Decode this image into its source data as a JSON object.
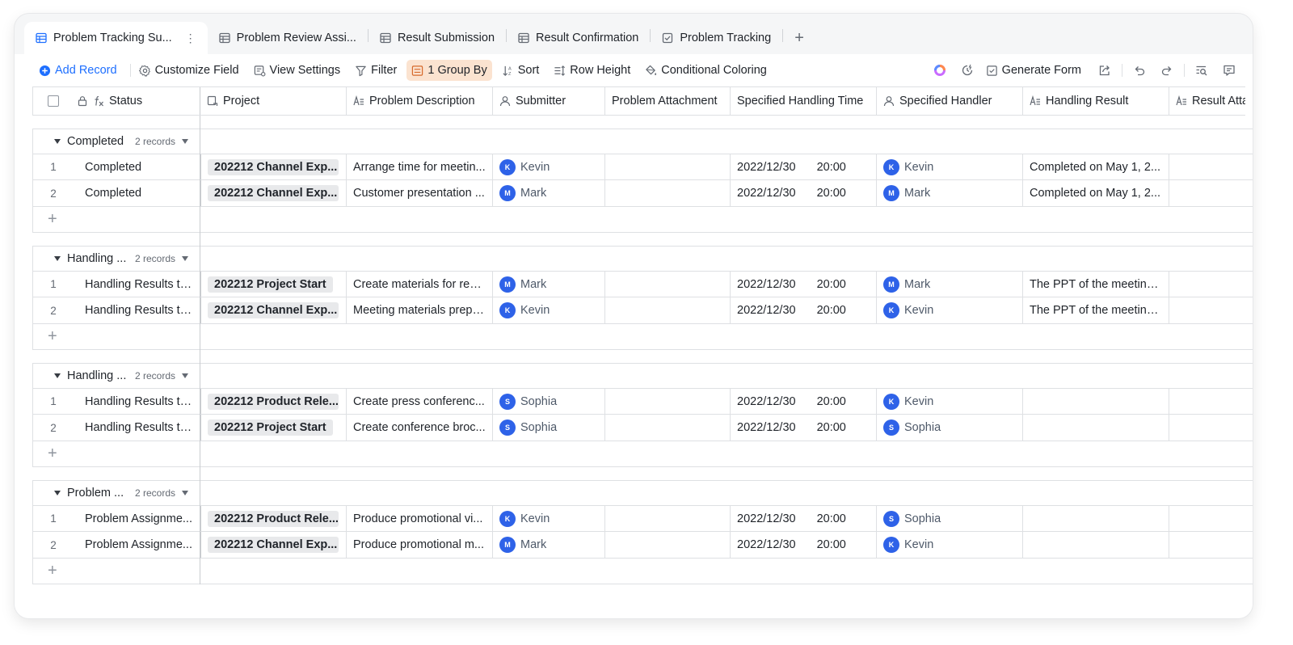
{
  "tabs": [
    {
      "label": "Problem Tracking Su...",
      "icon": "grid-table-icon",
      "active": true
    },
    {
      "label": "Problem Review Assi...",
      "icon": "grid-table-icon"
    },
    {
      "label": "Result Submission",
      "icon": "grid-table-icon"
    },
    {
      "label": "Result Confirmation",
      "icon": "grid-table-icon"
    },
    {
      "label": "Problem Tracking",
      "icon": "checkbox-form-icon"
    }
  ],
  "tab_more": "⋮",
  "tab_add": "+",
  "toolbar": {
    "add_record": "Add Record",
    "customize_field": "Customize Field",
    "view_settings": "View Settings",
    "filter": "Filter",
    "group_by": "1 Group By",
    "sort": "Sort",
    "row_height": "Row Height",
    "conditional_coloring": "Conditional Coloring",
    "generate_form": "Generate Form"
  },
  "columns": {
    "status": "Status",
    "project": "Project",
    "description": "Problem Description",
    "submitter": "Submitter",
    "attachment": "Problem Attachment",
    "time": "Specified Handling Time",
    "handler": "Specified Handler",
    "result": "Handling Result",
    "result_att": "Result Atta"
  },
  "add_row": "+",
  "groups": [
    {
      "name": "Completed",
      "count": "2 records",
      "rows": [
        {
          "n": "1",
          "status": "Completed",
          "project": "202212 Channel Exp...",
          "desc": "Arrange time for meetin...",
          "sub_i": "K",
          "sub": "Kevin",
          "date": "2022/12/30",
          "time": "20:00",
          "hand_i": "K",
          "hand": "Kevin",
          "result": "Completed on May 1, 2..."
        },
        {
          "n": "2",
          "status": "Completed",
          "project": "202212 Channel Exp...",
          "desc": "Customer presentation ...",
          "sub_i": "M",
          "sub": "Mark",
          "date": "2022/12/30",
          "time": "20:00",
          "hand_i": "M",
          "hand": "Mark",
          "result": "Completed on May 1, 2..."
        }
      ]
    },
    {
      "name": "Handling ...",
      "count": "2 records",
      "rows": [
        {
          "n": "1",
          "status": "Handling Results to...",
          "project": "202212 Project Start",
          "desc": "Create materials for regi...",
          "sub_i": "M",
          "sub": "Mark",
          "date": "2022/12/30",
          "time": "20:00",
          "hand_i": "M",
          "hand": "Mark",
          "result": "The PPT of the meeting ..."
        },
        {
          "n": "2",
          "status": "Handling Results to...",
          "project": "202212 Channel Exp...",
          "desc": "Meeting materials prepa...",
          "sub_i": "K",
          "sub": "Kevin",
          "date": "2022/12/30",
          "time": "20:00",
          "hand_i": "K",
          "hand": "Kevin",
          "result": "The PPT of the meeting ..."
        }
      ]
    },
    {
      "name": "Handling ...",
      "count": "2 records",
      "rows": [
        {
          "n": "1",
          "status": "Handling Results to...",
          "project": "202212 Product Rele...",
          "desc": "Create press conferenc...",
          "sub_i": "S",
          "sub": "Sophia",
          "date": "2022/12/30",
          "time": "20:00",
          "hand_i": "K",
          "hand": "Kevin",
          "result": ""
        },
        {
          "n": "2",
          "status": "Handling Results to...",
          "project": "202212 Project Start",
          "desc": "Create conference broc...",
          "sub_i": "S",
          "sub": "Sophia",
          "date": "2022/12/30",
          "time": "20:00",
          "hand_i": "S",
          "hand": "Sophia",
          "result": ""
        }
      ]
    },
    {
      "name": "Problem ...",
      "count": "2 records",
      "rows": [
        {
          "n": "1",
          "status": "Problem Assignme...",
          "project": "202212 Product Rele...",
          "desc": "Produce promotional vi...",
          "sub_i": "K",
          "sub": "Kevin",
          "date": "2022/12/30",
          "time": "20:00",
          "hand_i": "S",
          "hand": "Sophia",
          "result": ""
        },
        {
          "n": "2",
          "status": "Problem Assignme...",
          "project": "202212 Channel Exp...",
          "desc": "Produce promotional m...",
          "sub_i": "M",
          "sub": "Mark",
          "date": "2022/12/30",
          "time": "20:00",
          "hand_i": "K",
          "hand": "Kevin",
          "result": ""
        }
      ]
    }
  ],
  "colors": {
    "accent": "#1e6fff",
    "avatar": "#2e62e8",
    "group_by_bg": "#fbe3d0"
  }
}
